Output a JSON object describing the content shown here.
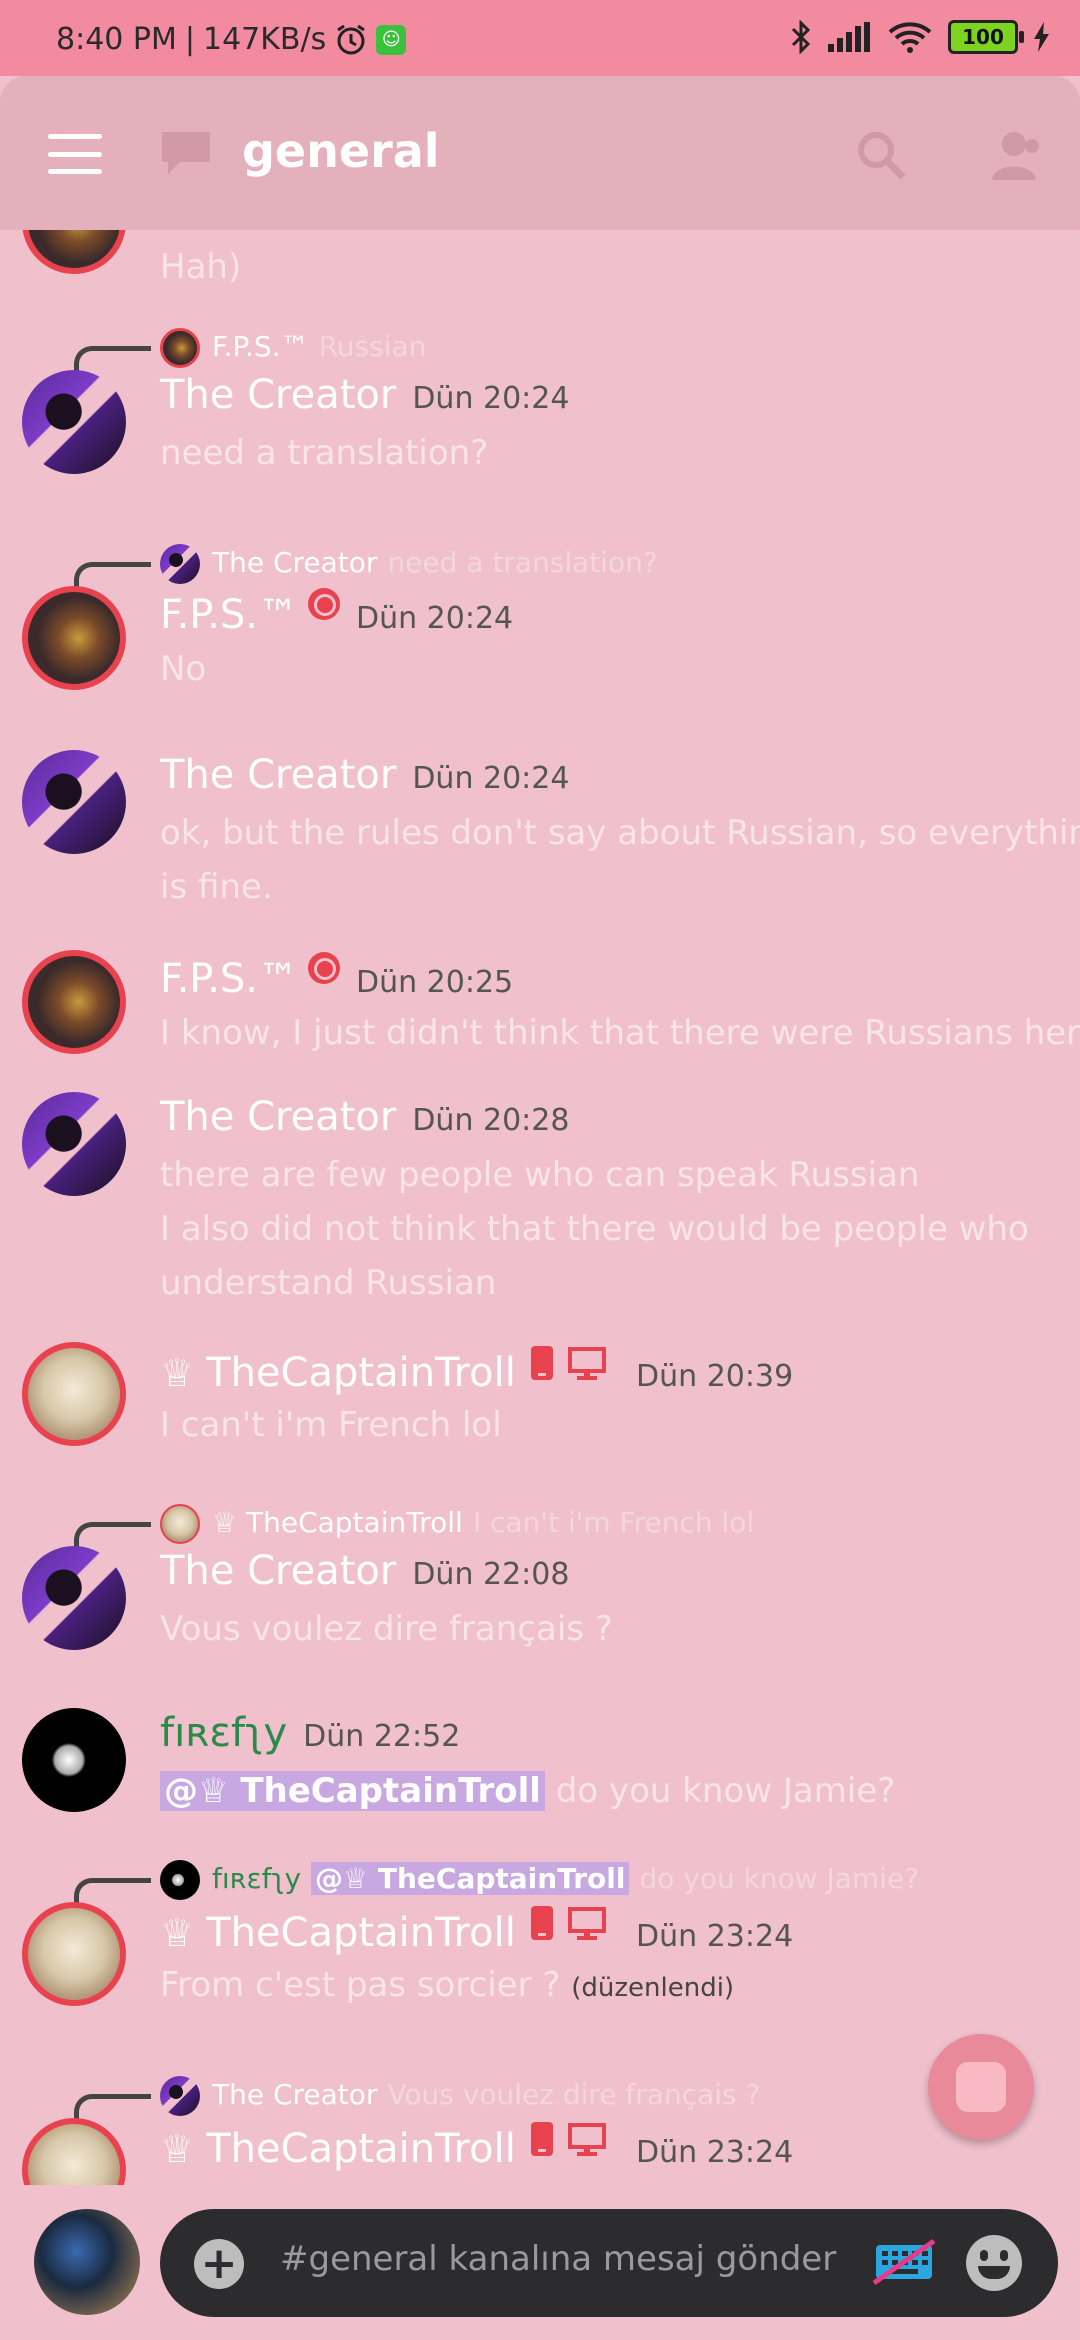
{
  "status": {
    "time": "8:40 PM",
    "speed": "147KB/s",
    "battery": "100"
  },
  "header": {
    "channel": "general"
  },
  "top_partial_text": "Hah)",
  "messages": [
    {
      "reply_to": {
        "author": "F.P.S.™",
        "text": "Russian"
      },
      "author": "The Creator",
      "time": "Dün 20:24",
      "lines": [
        "need a translation?"
      ]
    },
    {
      "reply_to": {
        "author": "The Creator",
        "text": "need a translation?"
      },
      "author": "F.P.S.™",
      "time": "Dün 20:24",
      "lines": [
        "No"
      ]
    },
    {
      "author": "The Creator",
      "time": "Dün 20:24",
      "lines": [
        "ok, but the rules don't say about Russian, so everything",
        "is fine."
      ]
    },
    {
      "author": "F.P.S.™",
      "time": "Dün 20:25",
      "lines": [
        "I know, I just didn't think that there were Russians here"
      ]
    },
    {
      "author": "The Creator",
      "time": "Dün 20:28",
      "lines": [
        "there are few people who can speak Russian",
        "I also did not think that there would be people who",
        "understand Russian"
      ]
    },
    {
      "author": "TheCaptainTroll",
      "time": "Dün 20:39",
      "lines": [
        "I can't i'm French lol"
      ]
    },
    {
      "reply_to": {
        "author": "TheCaptainTroll",
        "text": "I can't i'm French lol"
      },
      "author": "The Creator",
      "time": "Dün 22:08",
      "lines": [
        "Vous voulez dire français ?"
      ]
    },
    {
      "author": "fıʀɛfʅy",
      "time": "Dün 22:52",
      "mention": "@♕ TheCaptainTroll",
      "after_mention": " do you know Jamie?"
    },
    {
      "reply_to": {
        "author": "fıʀɛfʅy",
        "mention": "@♕ TheCaptainTroll",
        "text": "do you know Jamie?"
      },
      "author": "TheCaptainTroll",
      "time": "Dün 23:24",
      "lines": [
        "From c'est pas sorcier ?"
      ],
      "edited": "(düzenlendi)"
    },
    {
      "reply_to": {
        "author": "The Creator",
        "text": "Vous voulez dire français ?"
      },
      "author": "TheCaptainTroll",
      "time": "Dün 23:24"
    }
  ],
  "input": {
    "placeholder": "#general kanalına mesaj gönder"
  },
  "icons": [
    "menu-icon",
    "chat-bubble-icon",
    "search-icon",
    "members-icon",
    "globe-icon",
    "phone-icon",
    "desktop-icon",
    "plus-icon",
    "keyboard-off-icon",
    "emoji-icon",
    "bluetooth-icon",
    "signal-icon",
    "wifi-icon",
    "battery-icon",
    "alarm-icon"
  ],
  "colors": {
    "accent": "#e8424f",
    "background": "#f0c0cc",
    "header": "#e4b0bc",
    "status_bar": "#f28aa0"
  }
}
